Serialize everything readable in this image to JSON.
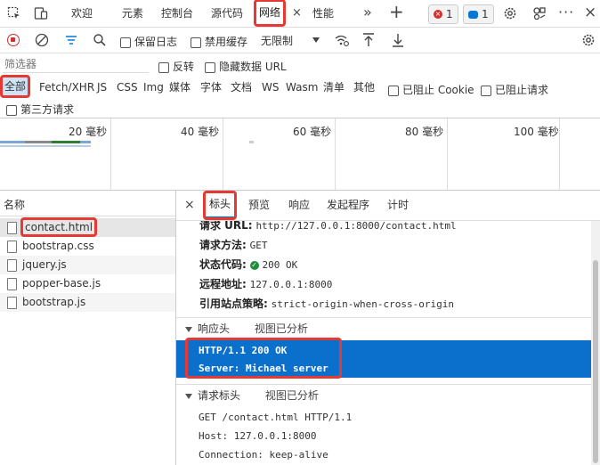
{
  "tabs": [
    {
      "label": "欢迎"
    },
    {
      "label": "元素"
    },
    {
      "label": "控制台"
    },
    {
      "label": "源代码"
    },
    {
      "label": "网络",
      "active": true
    },
    {
      "label": "性能"
    }
  ],
  "badges": {
    "errors": "1",
    "messages": "1"
  },
  "toolbar": {
    "preserve_log": "保留日志",
    "disable_cache": "禁用缓存",
    "throttle": "无限制"
  },
  "filter": {
    "placeholder": "筛选器",
    "invert": "反转",
    "hide_data_urls": "隐藏数据 URL"
  },
  "types": [
    "全部",
    "Fetch/XHR",
    "JS",
    "CSS",
    "Img",
    "媒体",
    "字体",
    "文档",
    "WS",
    "Wasm",
    "清单",
    "其他"
  ],
  "blocked": {
    "cookies": "已阻止 Cookie",
    "requests": "已阻止请求",
    "third_party": "第三方请求"
  },
  "timeline": {
    "ticks": [
      "20 毫秒",
      "40 毫秒",
      "60 毫秒",
      "80 毫秒",
      "100 毫秒"
    ]
  },
  "request_list": {
    "header": "名称",
    "items": [
      "contact.html",
      "bootstrap.css",
      "jquery.js",
      "popper-base.js",
      "bootstrap.js"
    ]
  },
  "detail": {
    "tabs": [
      "标头",
      "预览",
      "响应",
      "发起程序",
      "计时"
    ],
    "general": [
      {
        "key": "请求 URL:",
        "value": "http://127.0.0.1:8000/contact.html"
      },
      {
        "key": "请求方法:",
        "value": "GET"
      },
      {
        "key": "状态代码:",
        "value": "200 OK"
      },
      {
        "key": "远程地址:",
        "value": "127.0.0.1:8000"
      },
      {
        "key": "引用站点策略:",
        "value": "strict-origin-when-cross-origin"
      }
    ],
    "response_headers": {
      "title": "响应头",
      "toggle": "视图已分析",
      "lines": [
        "HTTP/1.1 200 OK",
        "Server: Michael server"
      ]
    },
    "request_headers": {
      "title": "请求标头",
      "toggle": "视图已分析",
      "lines": [
        "GET /contact.html HTTP/1.1",
        "Host: 127.0.0.1:8000",
        "Connection: keep-alive"
      ]
    }
  },
  "colors": {
    "accent": "#0078d4",
    "highlight": "#e53935",
    "record": "#d32f2f",
    "ok": "#1e8e3e"
  }
}
